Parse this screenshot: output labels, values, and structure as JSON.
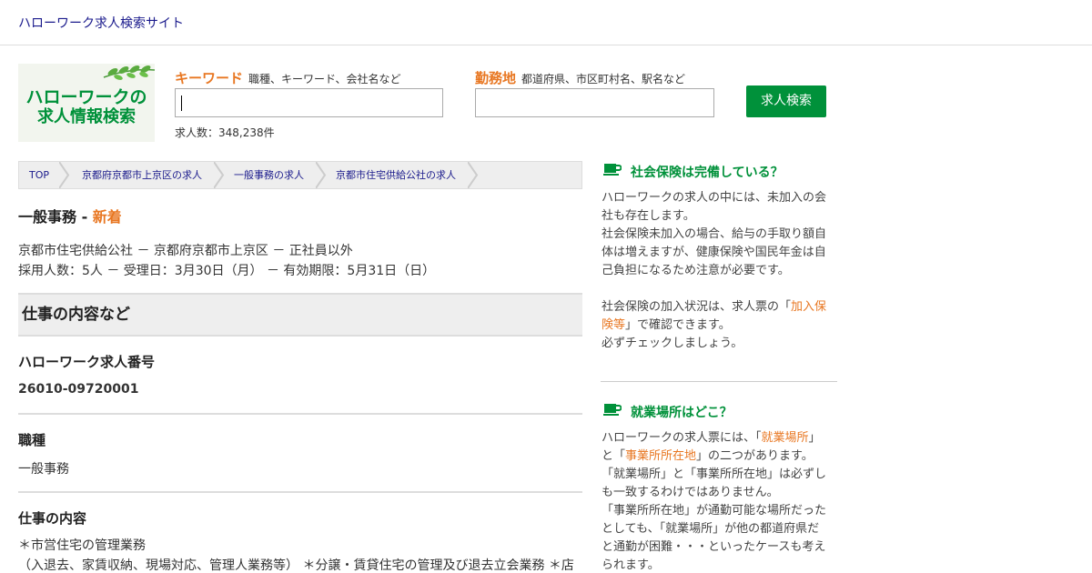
{
  "header": {
    "site_title": "ハローワーク求人検索サイト"
  },
  "logo": {
    "line1": "ハローワークの",
    "line2": "求人情報検索"
  },
  "search": {
    "keyword_label": "キーワード",
    "keyword_hint": "職種、キーワード、会社名など",
    "keyword_value": "",
    "location_label": "勤務地",
    "location_hint": "都道府県、市区町村名、駅名など",
    "location_value": "",
    "count_text": "求人数：348,238件",
    "button_label": "求人検索"
  },
  "breadcrumb": [
    "TOP",
    "京都府京都市上京区の求人",
    "一般事務の求人",
    "京都市住宅供給公社の求人"
  ],
  "job": {
    "title": "一般事務",
    "separator": " - ",
    "new_badge": "新着",
    "meta_line1": "京都市住宅供給公社 － 京都府京都市上京区 － 正社員以外",
    "meta_line2": "採用人数：5人 － 受理日：3月30日（月） － 有効期限：5月31日（日）"
  },
  "details": {
    "section_title": "仕事の内容など",
    "number_label": "ハローワーク求人番号",
    "number_value": "26010-09720001",
    "occupation_label": "職種",
    "occupation_value": "一般事務",
    "content_label": "仕事の内容",
    "content_line1": "＊市営住宅の管理業務",
    "content_line2": "（入退去、家賃収納、現場対応、管理人業務等） ＊分譲・賃貸住宅の管理及び退去立会業務 ＊店"
  },
  "sidebar": {
    "box1": {
      "title": "社会保険は完備している？",
      "p1_1": "ハローワークの求人の中には、未加入の会",
      "p1_2": "社も存在します。",
      "p1_3": "社会保険未加入の場合、給与の手取り額自",
      "p1_4": "体は増えますが、健康保険や国民年金は自",
      "p1_5": "己負担になるため注意が必要です。",
      "p2_pre": "社会保険の加入状況は、求人票の「",
      "p2_link_a": "加入保",
      "p2_link_b": "険等",
      "p2_post": "」で確認できます。",
      "p2_3": "必ずチェックしましょう。"
    },
    "box2": {
      "title": "就業場所はどこ？",
      "l1_pre": "ハローワークの求人票には、「",
      "l1_hl": "就業場所",
      "l1_post": "」",
      "l2_pre": "と「",
      "l2_hl": "事業所所在地",
      "l2_post": "」の二つがあります。",
      "l3": "「就業場所」と「事業所所在地」は必ずし",
      "l4": "も一致するわけではありません。",
      "l5": "「事業所所在地」が通勤可能な場所だった",
      "l6": "としても、「就業場所」が他の都道府県だ",
      "l7": "と通勤が困難・・・といったケースも考え",
      "l8": "られます。"
    }
  },
  "colors": {
    "accent_green": "#00913a",
    "accent_orange": "#e87722",
    "link_blue": "#1a1a8c"
  }
}
